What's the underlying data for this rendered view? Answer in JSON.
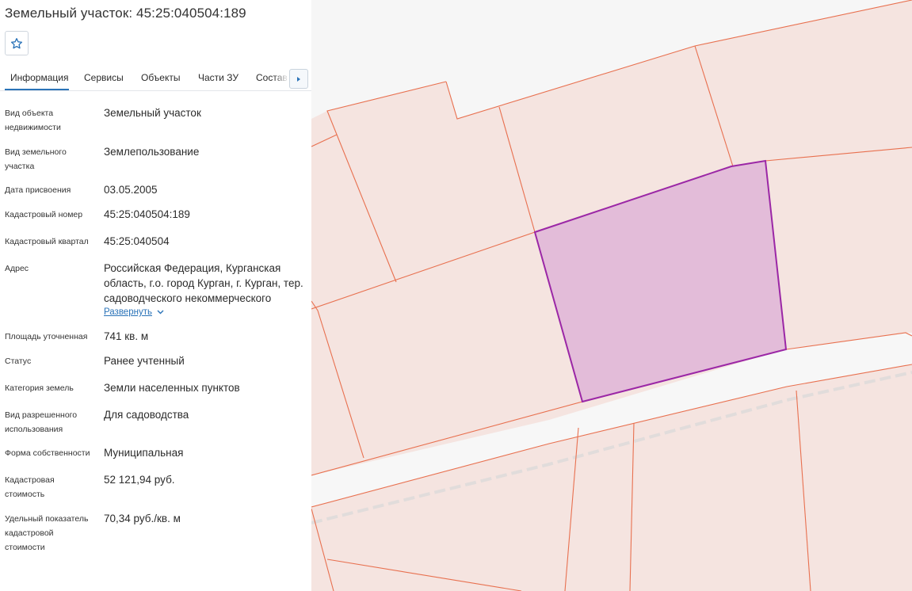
{
  "header": {
    "title": "Земельный участок: 45:25:040504:189",
    "favorite_icon": "star-icon"
  },
  "tabs": [
    {
      "label": "Информация",
      "active": true
    },
    {
      "label": "Сервисы"
    },
    {
      "label": "Объекты"
    },
    {
      "label": "Части ЗУ"
    },
    {
      "label": "Состав"
    }
  ],
  "tabs_scroll_icon": "chevron-right-icon",
  "fields": [
    {
      "label": "Вид объекта недвижимости",
      "value": "Земельный участок"
    },
    {
      "label": "Вид земельного участка",
      "value": "Землепользование"
    },
    {
      "label": "Дата присвоения",
      "value": "03.05.2005"
    },
    {
      "label": "Кадастровый номер",
      "value": "45:25:040504:189"
    },
    {
      "label": "Кадастровый квартал",
      "value": "45:25:040504"
    },
    {
      "label": "Адрес",
      "value": "Российская Федерация, Курганская область, г.о. город Курган, г. Курган, тер. садоводческого некоммерческого"
    },
    {
      "label": "Площадь уточненная",
      "value": "741 кв. м"
    },
    {
      "label": "Статус",
      "value": "Ранее учтенный"
    },
    {
      "label": "Категория земель",
      "value": "Земли населенных пунктов"
    },
    {
      "label": "Вид разрешенного использования",
      "value": "Для садоводства"
    },
    {
      "label": "Форма собственности",
      "value": "Муниципальная"
    },
    {
      "label": "Кадастровая стоимость",
      "value": "52 121,94 руб."
    },
    {
      "label": "Удельный показатель кадастровой стоимости",
      "value": "70,34 руб./кв. м"
    }
  ],
  "address_expand_label": "Развернуть",
  "colors": {
    "accent": "#2a73b8",
    "parcel_fill": "#f5e4e0",
    "parcel_border": "#e8704f",
    "selected_fill": "#e3bcd9",
    "selected_border": "#9b27a6",
    "road": "#f6f6f6"
  }
}
